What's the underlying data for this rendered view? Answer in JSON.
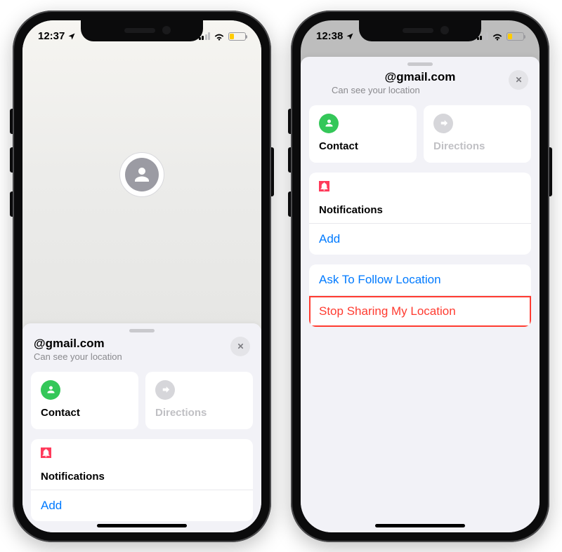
{
  "leftPhone": {
    "status": {
      "time": "12:37",
      "batteryPct": 30
    },
    "sheet": {
      "title": "@gmail.com",
      "subtitle": "Can see your location",
      "cards": {
        "contact": {
          "label": "Contact"
        },
        "directions": {
          "label": "Directions"
        }
      },
      "notifications": {
        "header": "Notifications",
        "add": "Add"
      }
    }
  },
  "rightPhone": {
    "status": {
      "time": "12:38",
      "batteryPct": 30
    },
    "sheet": {
      "title": "@gmail.com",
      "subtitle": "Can see your location",
      "cards": {
        "contact": {
          "label": "Contact"
        },
        "directions": {
          "label": "Directions"
        }
      },
      "notifications": {
        "header": "Notifications",
        "add": "Add"
      },
      "actions": {
        "askToFollow": "Ask To Follow Location",
        "stopSharing": "Stop Sharing My Location"
      }
    }
  }
}
